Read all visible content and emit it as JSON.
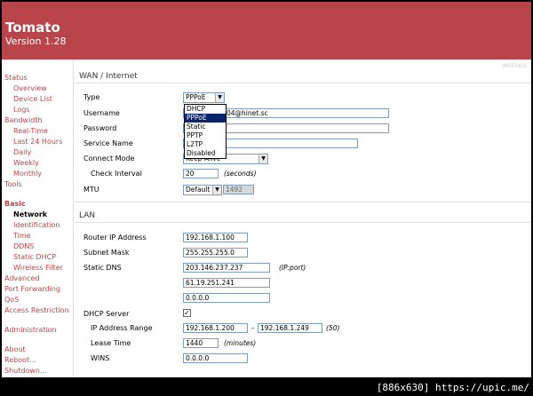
{
  "header": {
    "title": "Tomato",
    "version": "Version 1.28"
  },
  "model_label": "WRT54GL",
  "sidebar": {
    "items": [
      {
        "label": "Status"
      },
      {
        "label": "Overview"
      },
      {
        "label": "Device List"
      },
      {
        "label": "Logs"
      },
      {
        "label": "Bandwidth"
      },
      {
        "label": "Real-Time"
      },
      {
        "label": "Last 24 Hours"
      },
      {
        "label": "Daily"
      },
      {
        "label": "Weekly"
      },
      {
        "label": "Monthly"
      },
      {
        "label": "Tools"
      },
      {
        "label": "Basic"
      },
      {
        "label": "Network"
      },
      {
        "label": "Identification"
      },
      {
        "label": "Time"
      },
      {
        "label": "DDNS"
      },
      {
        "label": "Static DHCP"
      },
      {
        "label": "Wireless Filter"
      },
      {
        "label": "Advanced"
      },
      {
        "label": "Port Forwarding"
      },
      {
        "label": "QoS"
      },
      {
        "label": "Access Restriction"
      },
      {
        "label": "Administration"
      },
      {
        "label": "About"
      },
      {
        "label": "Reboot..."
      },
      {
        "label": "Shutdown..."
      }
    ]
  },
  "wan": {
    "title": "WAN / Internet",
    "type_label": "Type",
    "type_value": "PPPoE",
    "type_options": [
      "DHCP",
      "PPPoE",
      "Static",
      "PPTP",
      "L2TP",
      "Disabled"
    ],
    "username_label": "Username",
    "username_value": "04@hinet.sc",
    "password_label": "Password",
    "password_value": "",
    "service_label": "Service Name",
    "service_value": "",
    "connect_label": "Connect Mode",
    "connect_value": "Keep Alive",
    "check_label": "Check Interval",
    "check_value": "20",
    "check_unit": "(seconds)",
    "mtu_label": "MTU",
    "mtu_mode": "Default",
    "mtu_value": "1492"
  },
  "lan": {
    "title": "LAN",
    "router_ip_label": "Router IP Address",
    "router_ip_value": "192.168.1.100",
    "subnet_label": "Subnet Mask",
    "subnet_value": "255.255.255.0",
    "dns_label": "Static DNS",
    "dns_values": [
      "203.146.237.237",
      "61.19.251.241",
      "0.0.0.0"
    ],
    "dns_note": "(IP:port)",
    "dhcp_label": "DHCP Server",
    "dhcp_checked": "✓",
    "range_label": "IP Address Range",
    "range_start": "192.168.1.200",
    "range_sep": "-",
    "range_end": "192.168.1.249",
    "range_count": "(50)",
    "lease_label": "Lease Time",
    "lease_value": "1440",
    "lease_unit": "(minutes)",
    "wins_label": "WINS",
    "wins_value": "0.0.0.0"
  },
  "watermark": "[886x630] https://upic.me/"
}
